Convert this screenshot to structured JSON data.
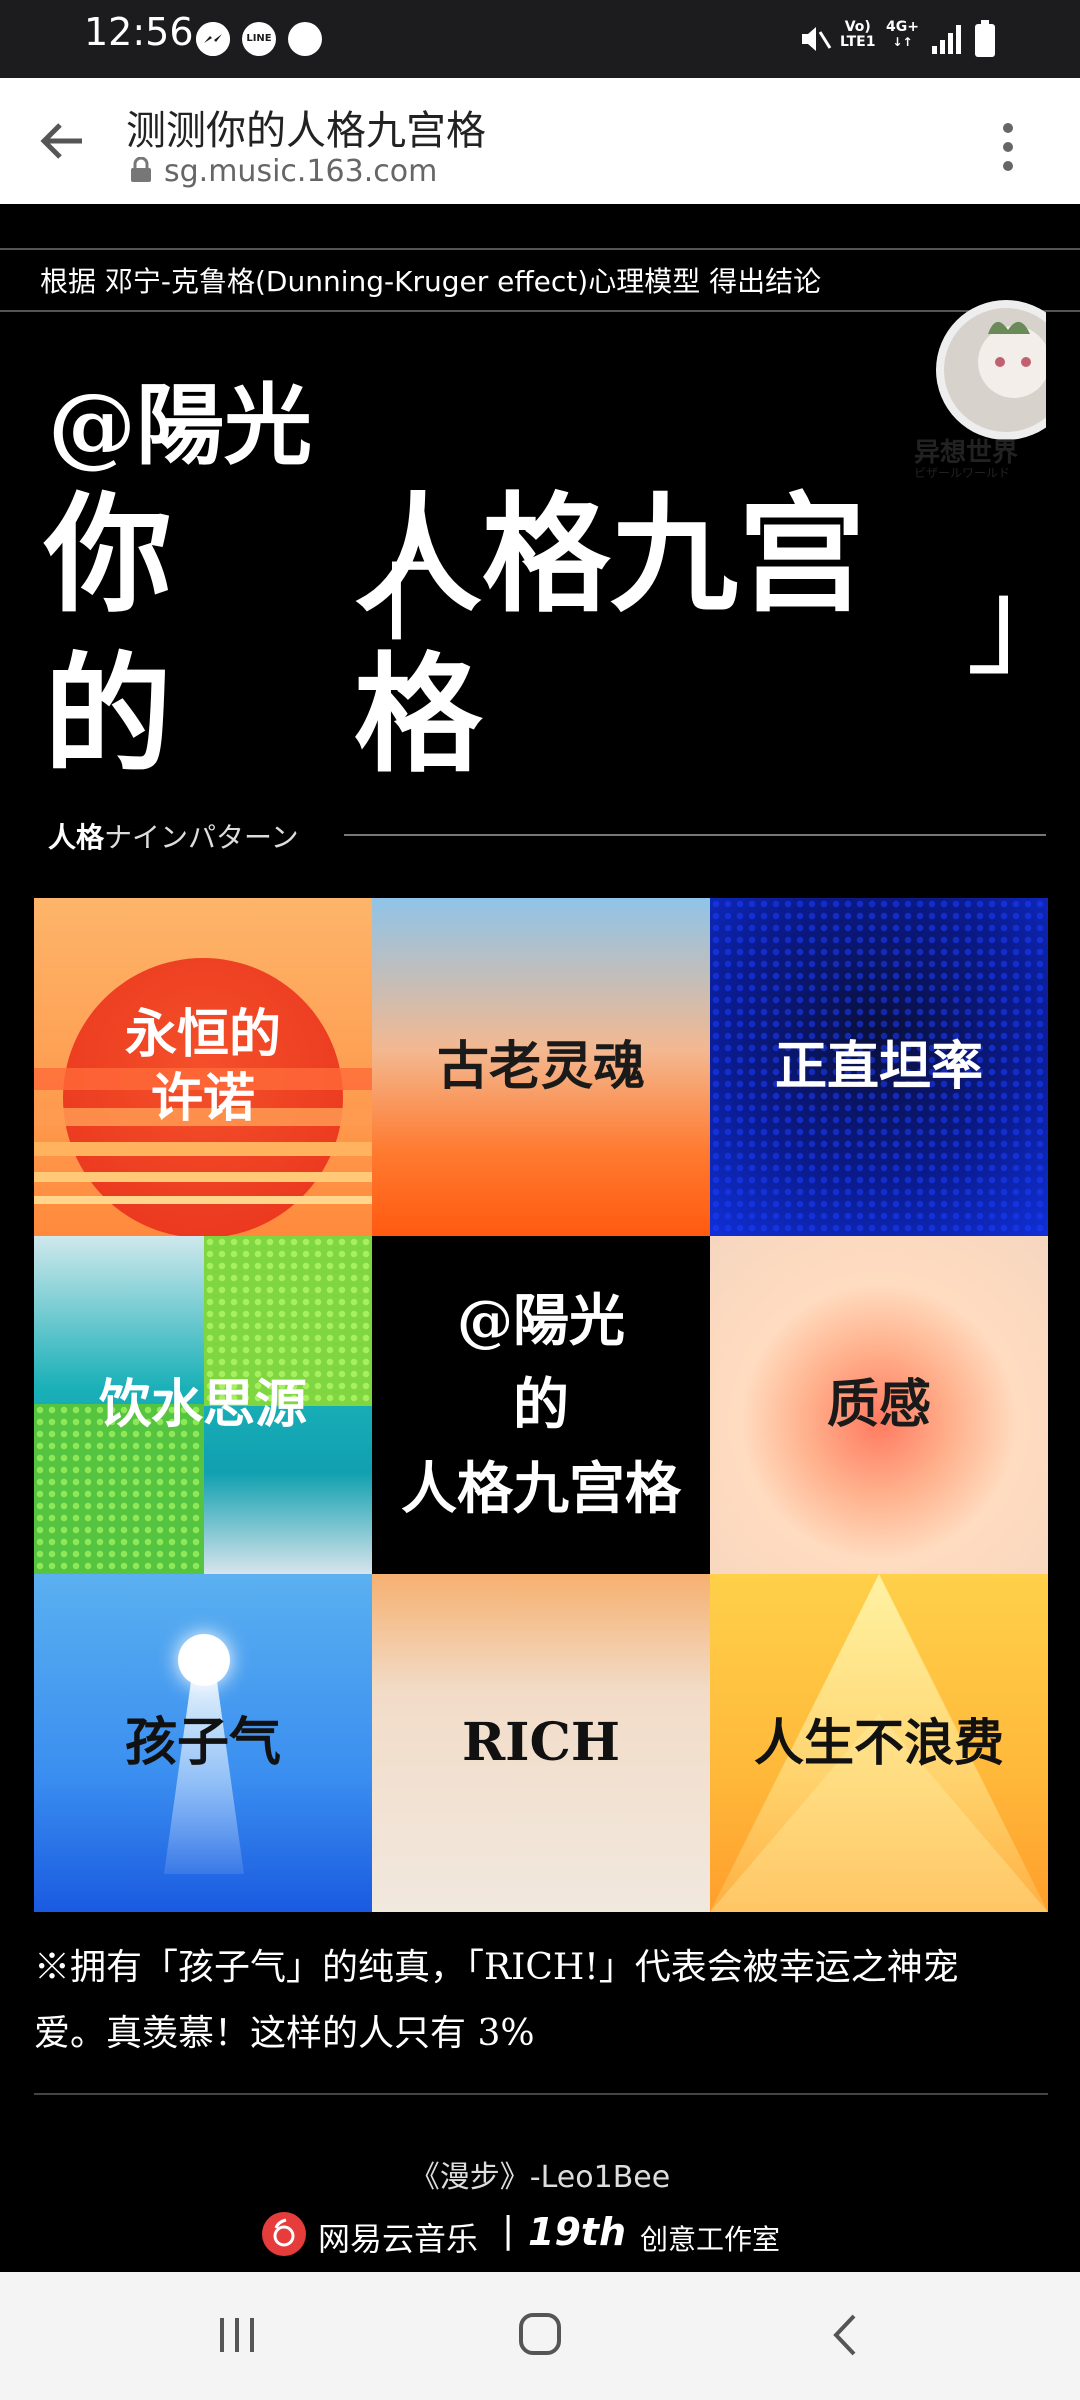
{
  "status_bar": {
    "time": "12:56",
    "notification_icons": [
      "messenger-icon",
      "line-icon",
      "messenger-icon"
    ],
    "network_label_top": "Vo)",
    "network_label_bottom": "LTE1",
    "network_type": "4G+"
  },
  "browser": {
    "page_title": "测测你的人格九宫格",
    "url": "sg.music.163.com"
  },
  "page": {
    "note": "根据 邓宁-克鲁格(Dunning-Kruger effect)心理模型 得出结论",
    "username": "@陽光",
    "title_you": "你",
    "title_de": "的",
    "title_main_line1": "人格九宫",
    "title_main_line2": "格",
    "bracket_open": "「",
    "bracket_close": "」",
    "subtitle_bold": "人格",
    "subtitle_rest": "ナインパターン",
    "badge_line1": "异想世界",
    "badge_line2": "ビザールワールド"
  },
  "grid": {
    "cells": [
      {
        "label_line1": "永恒的",
        "label_line2": "许诺"
      },
      {
        "label_line1": "古老灵魂",
        "label_line2": ""
      },
      {
        "label_line1": "正直坦率",
        "label_line2": ""
      },
      {
        "label_line1": "饮水思源",
        "label_line2": ""
      },
      {
        "label_line1": "@陽光",
        "label_line2": "的",
        "label_line3": "人格九宫格"
      },
      {
        "label_line1": "质感",
        "label_line2": ""
      },
      {
        "label_line1": "孩子气",
        "label_line2": ""
      },
      {
        "label_line1": "RICH",
        "label_line2": ""
      },
      {
        "label_line1": "人生不浪费",
        "label_line2": ""
      }
    ]
  },
  "footer": {
    "summary_line1": "※拥有「孩子气」的纯真，「RICH!」代表会被幸运之神宠",
    "summary_line2": "爱。真羡慕！这样的人只有 3%",
    "song": "《漫步》-Leo1Bee",
    "brand": "网易云音乐",
    "separator": "|",
    "studio_bold": "19th",
    "studio_rest": "创意工作室"
  },
  "colors": {
    "status_bar_bg": "#1c1c1e",
    "page_bg": "#000000",
    "browser_bg": "#ffffff",
    "netease_red": "#e63c3c"
  }
}
